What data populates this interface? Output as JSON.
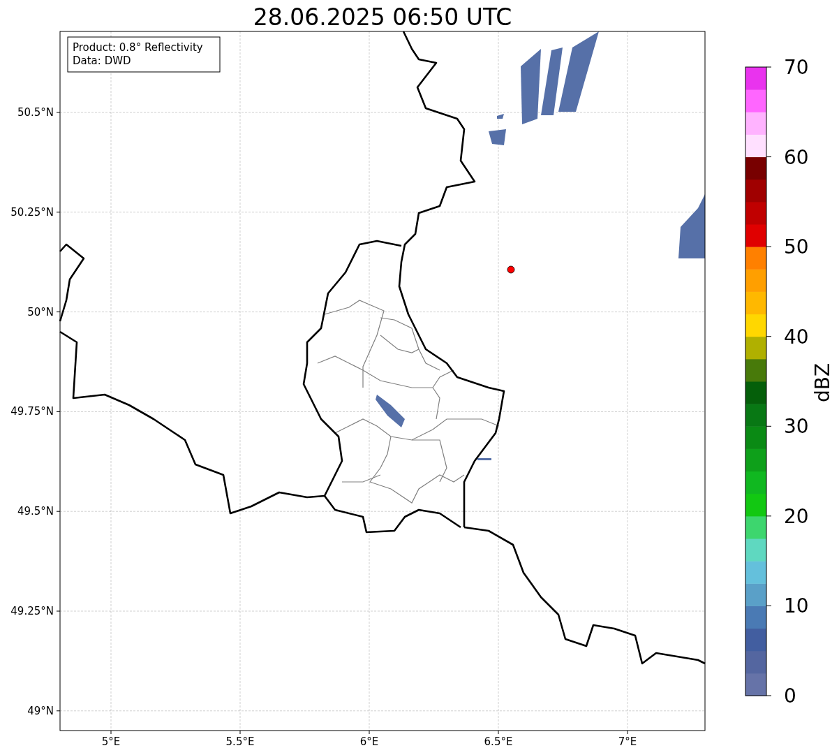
{
  "title": "28.06.2025 06:50 UTC",
  "info_box": {
    "lines": [
      "Product: 0.8° Reflectivity",
      "Data: DWD"
    ]
  },
  "map": {
    "lat_ticks": [
      "50.5°N",
      "50.25°N",
      "50°N",
      "49.75°N",
      "49.5°N",
      "49.25°N",
      "49°N"
    ],
    "lon_ticks": [
      "5°E",
      "5.5°E",
      "6°E",
      "6.5°E",
      "7°E"
    ]
  },
  "colorbar": {
    "label": "dBZ",
    "ticks": [
      "70",
      "60",
      "50",
      "40",
      "30",
      "20",
      "10",
      "0"
    ],
    "segments": [
      {
        "color": "#6673a8"
      },
      {
        "color": "#5466a0"
      },
      {
        "color": "#425ea0"
      },
      {
        "color": "#4a7ab4"
      },
      {
        "color": "#5aa0c8"
      },
      {
        "color": "#64c0dc"
      },
      {
        "color": "#5fd8c0"
      },
      {
        "color": "#3dd66e"
      },
      {
        "color": "#12c812"
      },
      {
        "color": "#10b820"
      },
      {
        "color": "#0ea01a"
      },
      {
        "color": "#0a8a14"
      },
      {
        "color": "#087814"
      },
      {
        "color": "#055f0a"
      },
      {
        "color": "#487a0a"
      },
      {
        "color": "#b0b000"
      },
      {
        "color": "#ffd700"
      },
      {
        "color": "#ffb800"
      },
      {
        "color": "#ff9f00"
      },
      {
        "color": "#ff8000"
      },
      {
        "color": "#e00000"
      },
      {
        "color": "#c00000"
      },
      {
        "color": "#a00000"
      },
      {
        "color": "#780000"
      },
      {
        "color": "#ffe0ff"
      },
      {
        "color": "#ffb3ff"
      },
      {
        "color": "#ff66ff"
      },
      {
        "color": "#e933ee"
      }
    ]
  }
}
